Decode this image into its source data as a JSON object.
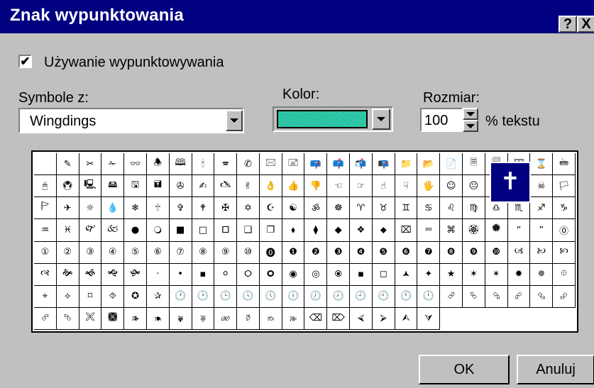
{
  "dialog": {
    "title": "Znak wypunktowania",
    "help_button": "?",
    "close_button": "X"
  },
  "bullets_checkbox": {
    "checked": true,
    "mark": "✔",
    "label": "Używanie wypunktowywania"
  },
  "symbol_from": {
    "label": "Symbole z:",
    "value": "Wingdings"
  },
  "color": {
    "label": "Kolor:",
    "value": "#2fd1b0"
  },
  "size": {
    "label": "Rozmiar:",
    "value": "100",
    "unit_label": "% tekstu"
  },
  "symbol_grid": {
    "columns": 24,
    "rows": 8,
    "selected_symbol": "✝",
    "symbols": [
      "",
      "✎",
      "✂",
      "✁",
      "👓",
      "🕭",
      "🕮",
      "🕯",
      "🕿",
      "✆",
      "🖂",
      "🖃",
      "📪",
      "📫",
      "📬",
      "📭",
      "📁",
      "📂",
      "📄",
      "🗏",
      "🗐",
      "🗄",
      "⌛",
      "🖮",
      "🖰",
      "🖲",
      "🖳",
      "🖴",
      "🖫",
      "🖬",
      "✇",
      "✍",
      "🖎",
      "✌",
      "👌",
      "👍",
      "👎",
      "☜",
      "☞",
      "☝",
      "☟",
      "🖐",
      "☺",
      "😐",
      "☹",
      "💣",
      "☠",
      "🏳",
      "🏱",
      "✈",
      "☼",
      "💧",
      "❄",
      "🕆",
      "✞",
      "🕈",
      "✠",
      "✡",
      "☪",
      "☯",
      "ॐ",
      "☸",
      "♈",
      "♉",
      "♊",
      "♋",
      "♌",
      "♍",
      "♎",
      "♏",
      "♐",
      "♑",
      "♒",
      "♓",
      "🙰",
      "🙵",
      "●",
      "🔾",
      "■",
      "□",
      "🞐",
      "❑",
      "❒",
      "⬧",
      "⧫",
      "◆",
      "❖",
      "⬥",
      "⌧",
      "⮹",
      "⌘",
      "🏵",
      "🏶",
      "🙶",
      "🙷",
      "⓪",
      "①",
      "②",
      "③",
      "④",
      "⑤",
      "⑥",
      "⑦",
      "⑧",
      "⑨",
      "⑩",
      "⓿",
      "❶",
      "❷",
      "❸",
      "❹",
      "❺",
      "❻",
      "❼",
      "❽",
      "❾",
      "❿",
      "🙢",
      "🙠",
      "🙡",
      "🙣",
      "🙞",
      "🙜",
      "🙝",
      "🙟",
      "·",
      "•",
      "▪",
      "⚪",
      "🞆",
      "🞈",
      "◉",
      "◎",
      "🞊",
      "▪",
      "◻",
      "🟂",
      "✦",
      "★",
      "✶",
      "✴",
      "✹",
      "✵",
      "⯐",
      "⌖",
      "⟡",
      "⌑",
      "⯑",
      "✪",
      "✰",
      "🕐",
      "🕑",
      "🕒",
      "🕓",
      "🕔",
      "🕕",
      "🕖",
      "🕗",
      "🕘",
      "🕙",
      "🕚",
      "🕛",
      "⮰",
      "⮱",
      "⮲",
      "⮳",
      "⮴",
      "⮵",
      "⮶",
      "⮷",
      "🙪",
      "🙫",
      "🙕",
      "🙔",
      "🙗",
      "🙖",
      "🙐",
      "🙑",
      "🙒",
      "🙓",
      "⌫",
      "⌦",
      "⮘",
      "⮚",
      "⮙",
      "⮛"
    ]
  },
  "buttons": {
    "ok": "OK",
    "cancel": "Anuluj"
  }
}
